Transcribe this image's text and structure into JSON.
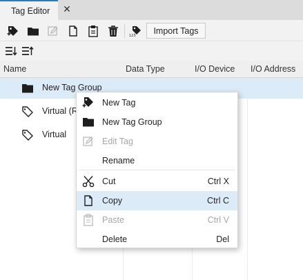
{
  "tab": {
    "title": "Tag Editor",
    "close_glyph": "✕"
  },
  "toolbar": {
    "icons": [
      "add-tag-icon",
      "new-folder-icon",
      "edit-icon",
      "copy-icon",
      "paste-icon",
      "delete-icon",
      "import-tag-icon"
    ],
    "import_label": "Import Tags"
  },
  "sortbar": {
    "icons": [
      "sort-descending-icon",
      "sort-ascending-icon"
    ]
  },
  "table": {
    "columns": [
      "Name",
      "Data Type",
      "I/O Device",
      "I/O Address"
    ],
    "rows": [
      {
        "label": "New Tag Group",
        "icon": "folder-icon",
        "selected": true
      },
      {
        "label": "Virtual (R",
        "icon": "tag-icon",
        "selected": false
      },
      {
        "label": "Virtual",
        "icon": "tag-icon",
        "selected": false
      }
    ]
  },
  "context_menu": {
    "items": [
      {
        "label": "New Tag",
        "shortcut": "",
        "icon": "add-tag-icon",
        "disabled": false
      },
      {
        "label": "New Tag Group",
        "shortcut": "",
        "icon": "folder-icon",
        "disabled": false
      },
      {
        "label": "Edit Tag",
        "shortcut": "",
        "icon": "edit-icon",
        "disabled": true
      },
      {
        "label": "Rename",
        "shortcut": "",
        "icon": "",
        "disabled": false
      },
      {
        "label": "Cut",
        "shortcut": "Ctrl X",
        "icon": "scissors-icon",
        "disabled": false
      },
      {
        "label": "Copy",
        "shortcut": "Ctrl C",
        "icon": "copy-icon",
        "disabled": false,
        "hovered": true
      },
      {
        "label": "Paste",
        "shortcut": "Ctrl V",
        "icon": "paste-icon",
        "disabled": true
      },
      {
        "label": "Delete",
        "shortcut": "Del",
        "icon": "",
        "disabled": false
      }
    ]
  },
  "colors": {
    "accent": "#2b79c2",
    "selection": "#dcebf8",
    "disabled_text": "#a6a6a6"
  }
}
